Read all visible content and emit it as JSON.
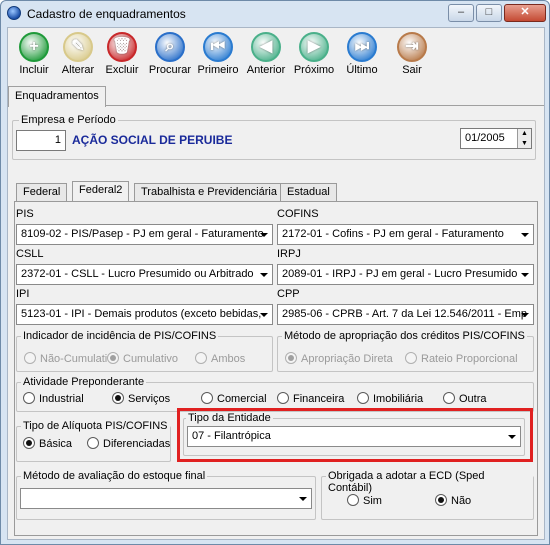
{
  "window": {
    "title": "Cadastro de enquadramentos",
    "minimize": "–",
    "maximize": "□",
    "close": "✕"
  },
  "toolbar": [
    {
      "label": "Incluir",
      "icon": "plus-icon",
      "color": "#1f9a3a",
      "glyph": "+"
    },
    {
      "label": "Alterar",
      "icon": "pencil-icon",
      "color": "#d8c98a",
      "glyph": "✎"
    },
    {
      "label": "Excluir",
      "icon": "trash-icon",
      "color": "#c8282a",
      "glyph": "🗑"
    },
    {
      "label": "Procurar",
      "icon": "magnifier-icon",
      "color": "#2a6fc9",
      "glyph": "⌕"
    },
    {
      "label": "Primeiro",
      "icon": "first-record-icon",
      "color": "#2a7bd0",
      "glyph": "⏮"
    },
    {
      "label": "Anterior",
      "icon": "previous-record-icon",
      "color": "#4ab08a",
      "glyph": "◀"
    },
    {
      "label": "Próximo",
      "icon": "next-record-icon",
      "color": "#4ab08a",
      "glyph": "▶"
    },
    {
      "label": "Último",
      "icon": "last-record-icon",
      "color": "#2a7bd0",
      "glyph": "⏭"
    },
    {
      "label": "Sair",
      "icon": "exit-door-icon",
      "color": "#b87a4a",
      "glyph": "⇥"
    }
  ],
  "main_tab": "Enquadramentos",
  "empresa": {
    "group_label": "Empresa e Período",
    "code": "1",
    "name": "AÇÃO SOCIAL DE PERUIBE",
    "period": "01/2005"
  },
  "subtabs": [
    "Federal",
    "Federal2",
    "Trabalhista e Previdenciária",
    "Estadual"
  ],
  "active_subtab": "Federal2",
  "fields": {
    "pis_label": "PIS",
    "pis_value": "8109-02 - PIS/Pasep - PJ em geral - Faturamento",
    "cofins_label": "COFINS",
    "cofins_value": "2172-01 - Cofins - PJ em geral - Faturamento",
    "csll_label": "CSLL",
    "csll_value": "2372-01 - CSLL - Lucro Presumido ou Arbitrado",
    "irpj_label": "IRPJ",
    "irpj_value": "2089-01 - IRPJ - PJ em geral - Lucro Presumido",
    "ipi_label": "IPI",
    "ipi_value": "5123-01 - IPI - Demais produtos (exceto bebidas,",
    "cpp_label": "CPP",
    "cpp_value": "2985-06 - CPRB - Art. 7 da Lei 12.546/2011 - Emp"
  },
  "indicador": {
    "label": "Indicador de incidência de PIS/COFINS",
    "options": [
      "Não-Cumulativo",
      "Cumulativo",
      "Ambos"
    ],
    "selected": 1
  },
  "metodo_apropriacao": {
    "label": "Método de apropriação dos créditos PIS/COFINS",
    "options": [
      "Apropriação Direta",
      "Rateio Proporcional"
    ],
    "selected": 0
  },
  "atividade": {
    "label": "Atividade Preponderante",
    "options": [
      "Industrial",
      "Serviços",
      "Comercial",
      "Financeira",
      "Imobiliária",
      "Outra"
    ],
    "selected": 1
  },
  "aliquota": {
    "label": "Tipo de Alíquota PIS/COFINS",
    "options": [
      "Básica",
      "Diferenciadas"
    ],
    "selected": 0
  },
  "entidade": {
    "label": "Tipo da Entidade",
    "value": "07 - Filantrópica",
    "highlight_color": "#e02020"
  },
  "estoque": {
    "label": "Método de avaliação do estoque final",
    "value": ""
  },
  "ecd": {
    "label": "Obrigada a adotar a ECD (Sped Contábil)",
    "options": [
      "Sim",
      "Não"
    ],
    "selected": 1
  }
}
